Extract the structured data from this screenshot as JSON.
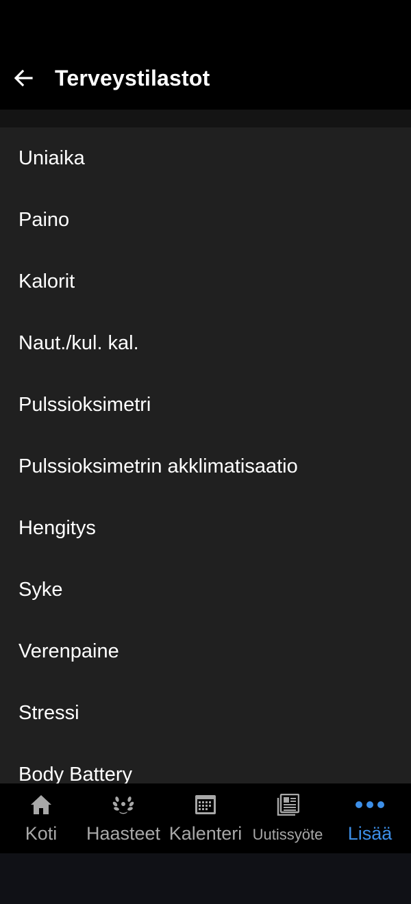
{
  "header": {
    "title": "Terveystilastot"
  },
  "list": {
    "items": [
      {
        "label": "Uniaika"
      },
      {
        "label": "Paino"
      },
      {
        "label": "Kalorit"
      },
      {
        "label": "Naut./kul. kal."
      },
      {
        "label": "Pulssioksimetri"
      },
      {
        "label": "Pulssioksimetrin akklimatisaatio"
      },
      {
        "label": "Hengitys"
      },
      {
        "label": "Syke"
      },
      {
        "label": "Verenpaine"
      },
      {
        "label": "Stressi"
      },
      {
        "label": "Body Battery"
      }
    ]
  },
  "bottom_nav": {
    "active_color": "#3d8fe8",
    "items": [
      {
        "label": "Koti",
        "icon": "home-icon"
      },
      {
        "label": "Haasteet",
        "icon": "laurel-icon"
      },
      {
        "label": "Kalenteri",
        "icon": "calendar-icon"
      },
      {
        "label": "Uutissyöte",
        "icon": "newsfeed-icon"
      },
      {
        "label": "Lisää",
        "icon": "more-dots-icon",
        "active": true
      }
    ]
  }
}
